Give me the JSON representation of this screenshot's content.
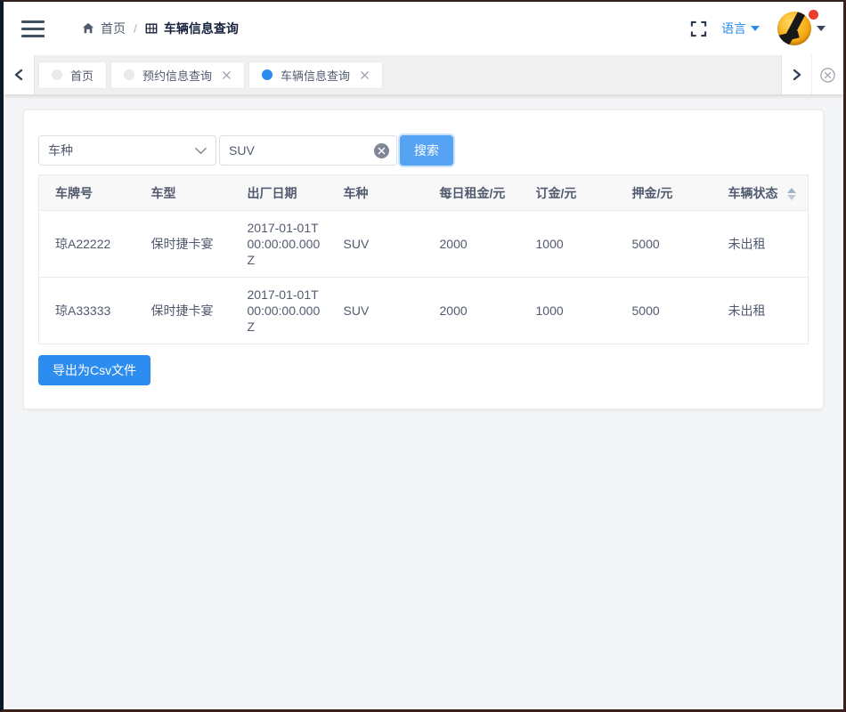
{
  "navbar": {
    "breadcrumb": {
      "home_label": "首页",
      "separator": "/",
      "current_label": "车辆信息查询"
    },
    "language_label": "语言"
  },
  "tabbar": {
    "tabs": [
      {
        "label": "首页",
        "closable": false,
        "active": false
      },
      {
        "label": "预约信息查询",
        "closable": true,
        "active": false
      },
      {
        "label": "车辆信息查询",
        "closable": true,
        "active": true
      }
    ]
  },
  "search": {
    "category_value": "车种",
    "keyword_value": "SUV",
    "button_label": "搜索"
  },
  "table": {
    "columns": [
      "车牌号",
      "车型",
      "出厂日期",
      "车种",
      "每日租金/元",
      "订金/元",
      "押金/元",
      "车辆状态"
    ],
    "sortable_column": "车辆状态",
    "rows": [
      [
        "琼A22222",
        "保时捷卡宴",
        "2017-01-01T00:00:00.000Z",
        "SUV",
        "2000",
        "1000",
        "5000",
        "未出租"
      ],
      [
        "琼A33333",
        "保时捷卡宴",
        "2017-01-01T00:00:00.000Z",
        "SUV",
        "2000",
        "1000",
        "5000",
        "未出租"
      ]
    ]
  },
  "export_button_label": "导出为Csv文件",
  "colors": {
    "primary": "#2d8cf0",
    "search_button": "#57a3f3",
    "active_tab_dot": "#2d8cf0",
    "inactive_tab_dot": "#e8eaec",
    "navbar_text": "#515a6e",
    "table_header_bg": "#f8f8f9",
    "sidebar_edge": "#0c1a28",
    "avatar_yellow": "#f8b424",
    "avatar_badge": "#e8402a"
  }
}
